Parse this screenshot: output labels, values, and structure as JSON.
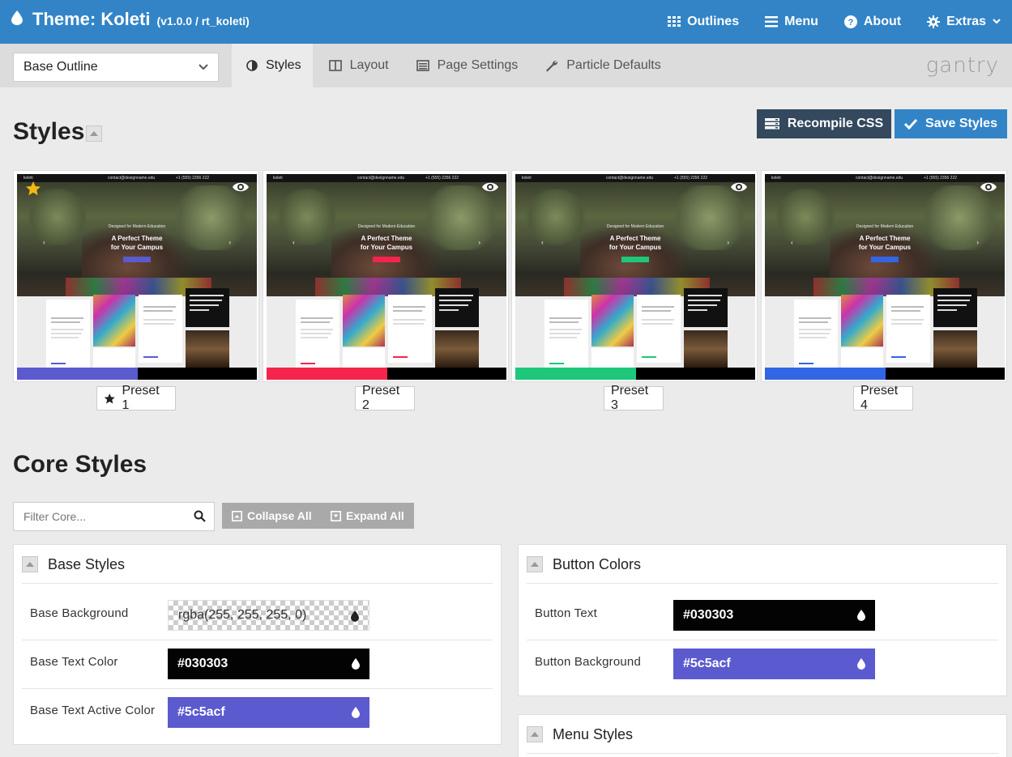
{
  "topbar": {
    "theme_title": "Theme: Koleti",
    "theme_version": "(v1.0.0 / rt_koleti)",
    "nav": [
      {
        "label": "Outlines",
        "icon": "grid-icon"
      },
      {
        "label": "Menu",
        "icon": "bars-icon"
      },
      {
        "label": "About",
        "icon": "question-circle-icon"
      },
      {
        "label": "Extras",
        "icon": "gear-icon"
      }
    ]
  },
  "subbar": {
    "outline_value": "Base Outline",
    "tabs": [
      {
        "label": "Styles",
        "icon": "half-circle-icon",
        "active": true
      },
      {
        "label": "Layout",
        "icon": "columns-icon",
        "active": false
      },
      {
        "label": "Page Settings",
        "icon": "list-icon",
        "active": false
      },
      {
        "label": "Particle Defaults",
        "icon": "wrench-icon",
        "active": false
      }
    ],
    "logo_text": "gantry"
  },
  "styles": {
    "heading": "Styles",
    "recompile_label": "Recompile CSS",
    "save_label": "Save Styles"
  },
  "presets": [
    {
      "label": "Preset 1",
      "accent": "#5c5acf",
      "active": true
    },
    {
      "label": "Preset 2",
      "accent": "#f5244c",
      "active": false
    },
    {
      "label": "Preset 3",
      "accent": "#1ec779",
      "active": false
    },
    {
      "label": "Preset 4",
      "accent": "#3266e5",
      "active": false
    }
  ],
  "preset_thumb": {
    "nav_left": "koleti",
    "nav_mid": "contact@designname.edu",
    "nav_right": "+1 (555) 2356 222",
    "tagline": "Designed for Modern Education",
    "headline_1": "A Perfect Theme",
    "headline_2": "for Your Campus",
    "quote": "Every child is an artist. The problem is how to remain an artist once we grow up.",
    "img_text": "One of our students gets more great ideas and we want to brag.",
    "card_name": "David Williams",
    "read_more": "Read more"
  },
  "core": {
    "heading": "Core Styles",
    "filter_placeholder": "Filter Core...",
    "collapse_all": "Collapse All",
    "expand_all": "Expand All"
  },
  "base_styles": {
    "title": "Base Styles",
    "rows": [
      {
        "label": "Base Background",
        "value": "rgba(255, 255, 255, 0)",
        "color": "transparent"
      },
      {
        "label": "Base Text Color",
        "value": "#030303",
        "color": "#030303"
      },
      {
        "label": "Base Text Active Color",
        "value": "#5c5acf",
        "color": "#5c5acf"
      }
    ]
  },
  "button_colors": {
    "title": "Button Colors",
    "rows": [
      {
        "label": "Button Text",
        "value": "#030303",
        "color": "#030303"
      },
      {
        "label": "Button Background",
        "value": "#5c5acf",
        "color": "#5c5acf"
      }
    ]
  },
  "menu_styles": {
    "title": "Menu Styles"
  }
}
